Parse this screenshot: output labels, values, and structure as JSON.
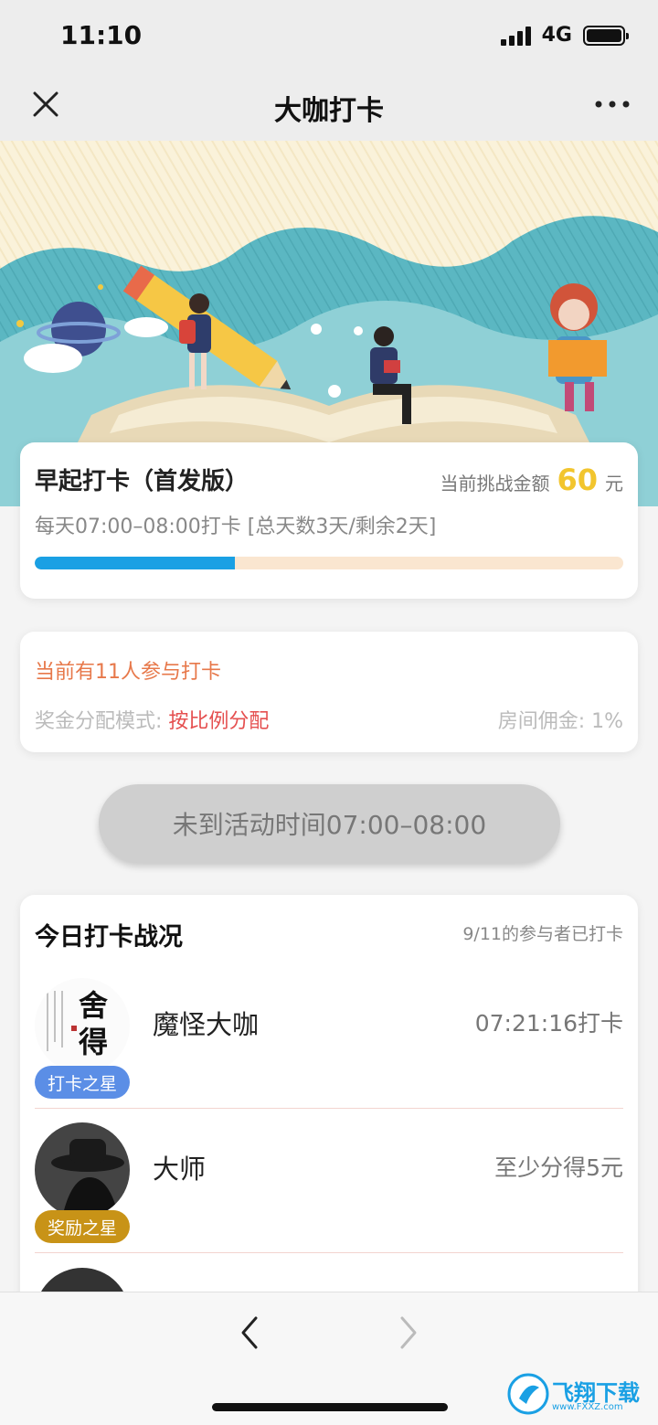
{
  "status_bar": {
    "time": "11:10",
    "network": "4G"
  },
  "nav": {
    "title": "大咖打卡"
  },
  "challenge": {
    "title": "早起打卡（首发版）",
    "amount_label": "当前挑战金额",
    "amount": "60",
    "amount_unit": "元",
    "schedule": "每天07:00–08:00打卡 [总天数3天/剩余2天]",
    "progress": 0.34
  },
  "info": {
    "participants": "当前有11人参与打卡",
    "mode_label": "奖金分配模式: ",
    "mode_value": "按比例分配",
    "commission": "房间佣金: 1%"
  },
  "action": {
    "status_text": "未到活动时间07:00–08:00"
  },
  "today": {
    "title": "今日打卡战况",
    "summary": "9/11的参与者已打卡",
    "rows": [
      {
        "name": "魔怪大咖",
        "badge": "打卡之星",
        "value": "07:21:16打卡",
        "avatar_text": "舍得"
      },
      {
        "name": "大师",
        "badge": "奖励之星",
        "value": "至少分得5元"
      }
    ]
  },
  "watermark": {
    "text": "飞翔下载",
    "url_text": "www.FXXZ.com"
  },
  "colors": {
    "accent_blue": "#1aa0e4",
    "amount_yellow": "#f2c52e",
    "orange_text": "#e7784a",
    "red_text": "#e55050",
    "badge_blue": "#5b8ee6",
    "badge_gold": "#c89317"
  }
}
